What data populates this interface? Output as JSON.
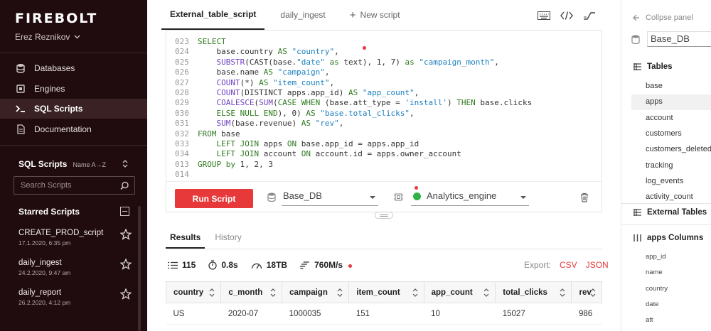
{
  "brand": "FIREBOLT",
  "user": "Erez Reznikov",
  "nav": [
    {
      "label": "Databases",
      "icon": "database-icon"
    },
    {
      "label": "Engines",
      "icon": "engine-icon"
    },
    {
      "label": "SQL Scripts",
      "icon": "terminal-icon",
      "active": true
    },
    {
      "label": "Documentation",
      "icon": "document-icon"
    }
  ],
  "scripts": {
    "title": "SQL Scripts",
    "sort_label": "Name A→Z",
    "search_placeholder": "Search Scripts",
    "starred_title": "Starred Scripts",
    "starred": [
      {
        "name": "CREATE_PROD_script",
        "date": "17.1.2020, 6:35 pm"
      },
      {
        "name": "daily_ingest",
        "date": "24.2.2020, 9:47 am"
      },
      {
        "name": "daily_report",
        "date": "26.2.2020, 4:12 pm"
      }
    ]
  },
  "tabs": {
    "active": "External_table_script",
    "second": "daily_ingest",
    "new": "New script"
  },
  "editor": {
    "lines": [
      {
        "n": "023",
        "parts": [
          [
            "kw",
            "SELECT"
          ]
        ]
      },
      {
        "n": "024",
        "parts": [
          [
            "tx",
            "    base.country "
          ],
          [
            "kw",
            "AS"
          ],
          [
            "st",
            " \"country\""
          ],
          [
            "tx",
            ","
          ]
        ]
      },
      {
        "n": "025",
        "parts": [
          [
            "tx",
            "    "
          ],
          [
            "fn",
            "SUBSTR"
          ],
          [
            "tx",
            "(CAST(base."
          ],
          [
            "st",
            "\"date\""
          ],
          [
            "tx",
            " "
          ],
          [
            "kw",
            "as"
          ],
          [
            "tx",
            " text), 1, 7) "
          ],
          [
            "kw",
            "as"
          ],
          [
            "st",
            " \"campaign_month\""
          ],
          [
            "tx",
            ","
          ]
        ]
      },
      {
        "n": "026",
        "parts": [
          [
            "tx",
            "    base.name "
          ],
          [
            "kw",
            "AS"
          ],
          [
            "st",
            " \"campaign\""
          ],
          [
            "tx",
            ","
          ]
        ]
      },
      {
        "n": "027",
        "parts": [
          [
            "tx",
            "    "
          ],
          [
            "fn",
            "COUNT"
          ],
          [
            "tx",
            "(*) "
          ],
          [
            "kw",
            "AS"
          ],
          [
            "st",
            " \"item_count\""
          ],
          [
            "tx",
            ","
          ]
        ]
      },
      {
        "n": "028",
        "parts": [
          [
            "tx",
            "    "
          ],
          [
            "fn",
            "COUNT"
          ],
          [
            "tx",
            "(DISTINCT apps.app_id) "
          ],
          [
            "kw",
            "AS"
          ],
          [
            "st",
            " \"app_count\""
          ],
          [
            "tx",
            ","
          ]
        ]
      },
      {
        "n": "029",
        "parts": [
          [
            "tx",
            "    "
          ],
          [
            "fn",
            "COALESCE"
          ],
          [
            "tx",
            "("
          ],
          [
            "fn",
            "SUM"
          ],
          [
            "tx",
            "("
          ],
          [
            "kw",
            "CASE WHEN"
          ],
          [
            "tx",
            " (base.att_type = "
          ],
          [
            "st",
            "'install'"
          ],
          [
            "tx",
            ") "
          ],
          [
            "kw",
            "THEN"
          ],
          [
            "tx",
            " base.clicks"
          ]
        ]
      },
      {
        "n": "030",
        "parts": [
          [
            "tx",
            "    "
          ],
          [
            "kw",
            "ELSE NULL END"
          ],
          [
            "tx",
            "), 0) "
          ],
          [
            "kw",
            "AS"
          ],
          [
            "st",
            " \"base.total_clicks\""
          ],
          [
            "tx",
            ","
          ]
        ]
      },
      {
        "n": "031",
        "parts": [
          [
            "tx",
            "    "
          ],
          [
            "fn",
            "SUM"
          ],
          [
            "tx",
            "(base.revenue) "
          ],
          [
            "kw",
            "AS"
          ],
          [
            "st",
            " \"rev\""
          ],
          [
            "tx",
            ","
          ]
        ]
      },
      {
        "n": "032",
        "parts": [
          [
            "kw",
            "FROM"
          ],
          [
            "tx",
            " base"
          ]
        ]
      },
      {
        "n": "033",
        "parts": [
          [
            "tx",
            "    "
          ],
          [
            "kw",
            "LEFT JOIN"
          ],
          [
            "tx",
            " apps "
          ],
          [
            "kw",
            "ON"
          ],
          [
            "tx",
            " base.app_id = apps.app_id"
          ]
        ]
      },
      {
        "n": "034",
        "parts": [
          [
            "tx",
            "    "
          ],
          [
            "kw",
            "LEFT JOIN"
          ],
          [
            "tx",
            " account "
          ],
          [
            "kw",
            "ON"
          ],
          [
            "tx",
            " account.id = apps.owner_account"
          ]
        ]
      },
      {
        "n": "013",
        "parts": [
          [
            "kw",
            "GROUP by"
          ],
          [
            "tx",
            " 1, 2, 3"
          ]
        ]
      },
      {
        "n": "014",
        "parts": []
      }
    ],
    "run_label": "Run Script",
    "database": "Base_DB",
    "engine": "Analytics_engine"
  },
  "results": {
    "tab_results": "Results",
    "tab_history": "History",
    "rows_count": "115",
    "duration": "0.8s",
    "scanned": "18TB",
    "speed": "760M/s",
    "export_label": "Export:",
    "export_csv": "CSV",
    "export_json": "JSON",
    "columns": [
      "country",
      "c_month",
      "campaign",
      "item_count",
      "app_count",
      "total_clicks",
      "rev"
    ],
    "rows": [
      [
        "US",
        "2020-07",
        "1000035",
        "151",
        "10",
        "15027",
        "986"
      ]
    ]
  },
  "right_panel": {
    "collapse_label": "Collpse panel",
    "database": "Base_DB",
    "tables_title": "Tables",
    "tables": [
      "base",
      "apps",
      "account",
      "customers",
      "customers_deleted",
      "tracking",
      "log_events",
      "activity_count"
    ],
    "selected_table": "apps",
    "external_title": "External Tables",
    "columns_title": "apps Columns",
    "columns": [
      "app_id",
      "name",
      "country",
      "date",
      "att"
    ]
  }
}
